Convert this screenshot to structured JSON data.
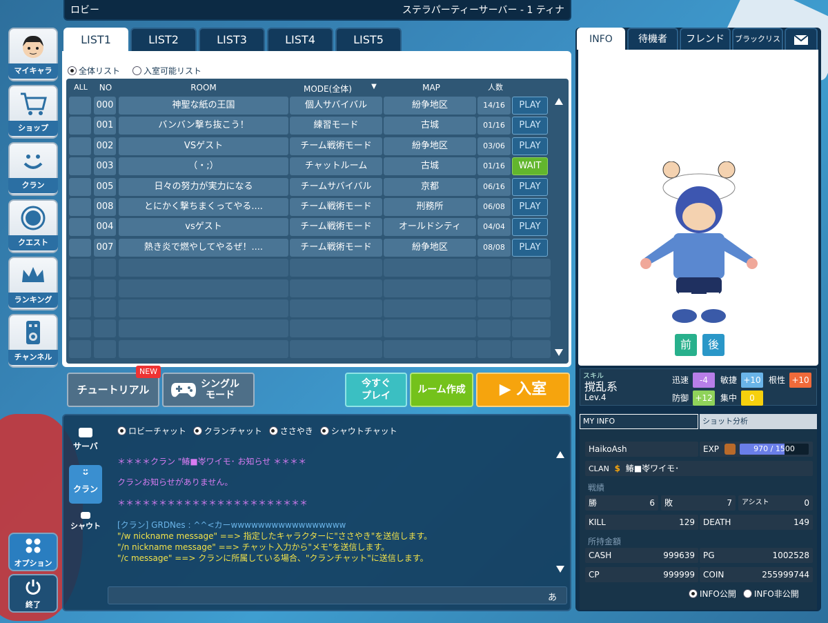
{
  "topbar": {
    "title": "ロビー",
    "server": "ステラパーティーサーバー - 1 ティナ"
  },
  "nav": [
    {
      "label": "マイキャラ",
      "icon": "avatar-icon"
    },
    {
      "label": "ショップ",
      "icon": "cart-icon"
    },
    {
      "label": "クラン",
      "icon": "smile-icon"
    },
    {
      "label": "クエスト",
      "icon": "quest-icon"
    },
    {
      "label": "ランキング",
      "icon": "crown-icon"
    },
    {
      "label": "チャンネル",
      "icon": "speaker-icon"
    },
    {
      "label": "オプション",
      "icon": "grid-icon"
    },
    {
      "label": "終了",
      "icon": "power-icon"
    }
  ],
  "tabs": [
    "LIST1",
    "LIST2",
    "LIST3",
    "LIST4",
    "LIST5"
  ],
  "filter": {
    "all": "全体リスト",
    "available": "入室可能リスト"
  },
  "table": {
    "headers": {
      "all": "ALL",
      "no": "NO",
      "room": "ROOM",
      "mode": "MODE(全体)",
      "mode_arrow": "▼",
      "map": "MAP",
      "count": "人数"
    },
    "rows": [
      {
        "no": "000",
        "room": "神聖な紙の王国",
        "mode": "個人サバイバル",
        "map": "紛争地区",
        "count": "14/16",
        "action": "PLAY"
      },
      {
        "no": "001",
        "room": "バンバン撃ち抜こう！",
        "mode": "練習モード",
        "map": "古城",
        "count": "01/16",
        "action": "PLAY"
      },
      {
        "no": "002",
        "room": "VSゲスト",
        "mode": "チーム戦術モード",
        "map": "紛争地区",
        "count": "03/06",
        "action": "PLAY"
      },
      {
        "no": "003",
        "room": "（・;）",
        "mode": "チャットルーム",
        "map": "古城",
        "count": "01/16",
        "action": "WAIT"
      },
      {
        "no": "005",
        "room": "日々の努力が実力になる",
        "mode": "チームサバイバル",
        "map": "京都",
        "count": "06/16",
        "action": "PLAY"
      },
      {
        "no": "008",
        "room": "とにかく撃ちまくってやる....",
        "mode": "チーム戦術モード",
        "map": "刑務所",
        "count": "06/08",
        "action": "PLAY"
      },
      {
        "no": "004",
        "room": "vsゲスト",
        "mode": "チーム戦術モード",
        "map": "オールドシティ",
        "count": "04/04",
        "action": "PLAY"
      },
      {
        "no": "007",
        "room": "熱き炎で燃やしてやるぜ！....",
        "mode": "チーム戦術モード",
        "map": "紛争地区",
        "count": "08/08",
        "action": "PLAY"
      }
    ]
  },
  "buttons": {
    "tutorial": "チュートリアル",
    "new_badge": "NEW",
    "single_1": "シングル",
    "single_2": "モード",
    "play_now_1": "今すぐ",
    "play_now_2": "プレイ",
    "create_room": "ルーム作成",
    "enter": "▶ 入室"
  },
  "chat": {
    "side": [
      "サーバ",
      "クラン",
      "シャウト"
    ],
    "channels": [
      "ロビーチャット",
      "クランチャット",
      "ささやき",
      "シャウトチャット"
    ],
    "lines": [
      {
        "text": "＊＊＊＊クラン \"鰆■岺ワイモ･ お知らせ ＊＊＊＊",
        "color": "#d77cf2"
      },
      {
        "text": "クランお知らせがありません。",
        "color": "#d77cf2"
      },
      {
        "text": "＊＊＊＊＊＊＊＊＊＊＊＊＊＊＊＊＊＊＊＊＊＊＊",
        "color": "#d77cf2"
      },
      {
        "text": "[クラン] GRDNes : ^^<カーwwwwwwwwwwwwwwwww",
        "color": "#6ab4e8"
      },
      {
        "text": "\"/w nickname message\" ==> 指定したキャラクターに\"ささやき\"を送信します。",
        "color": "#f2e24a"
      },
      {
        "text": "\"/n nickname message\" ==> チャット入力から\"メモ\"を送信します。",
        "color": "#f2e24a"
      },
      {
        "text": "\"/c message\" ==> クランに所属している場合、\"クランチャット\"に送信します。",
        "color": "#f2e24a"
      }
    ],
    "ime": "あ"
  },
  "right": {
    "tabs": [
      "INFO",
      "待機者",
      "フレンド",
      "ブラックリスト"
    ],
    "mail_icon": "mail-icon",
    "front": "前",
    "back": "後",
    "skill": {
      "label": "スキル",
      "name": "撹乱系",
      "level": "Lev.4"
    },
    "stats": [
      {
        "k": "迅速",
        "v": "-4"
      },
      {
        "k": "敏捷",
        "v": "+10"
      },
      {
        "k": "根性",
        "v": "+10"
      },
      {
        "k": "防御",
        "v": "+12"
      },
      {
        "k": "集中",
        "v": "0"
      }
    ],
    "subtabs": [
      "MY INFO",
      "ショット分析"
    ],
    "name": "HaikoAsh",
    "exp_label": "EXP",
    "exp_value": "970 / 1500",
    "exp_fraction": 0.65,
    "clan_label": "CLAN",
    "clan_name": "鰆■岺ワイモ･",
    "record_label": "戦績",
    "record": {
      "win_label": "勝",
      "win": "6",
      "lose_label": "敗",
      "lose": "7",
      "assist_label": "アシスト",
      "assist": "0",
      "kill_label": "KILL",
      "kill": "129",
      "death_label": "DEATH",
      "death": "149"
    },
    "money_label": "所持金額",
    "money": {
      "cash_label": "CASH",
      "cash": "999639",
      "pg_label": "PG",
      "pg": "1002528",
      "cp_label": "CP",
      "cp": "999999",
      "coin_label": "COIN",
      "coin": "255999744"
    },
    "public": "INFO公開",
    "private": "INFO非公開"
  }
}
